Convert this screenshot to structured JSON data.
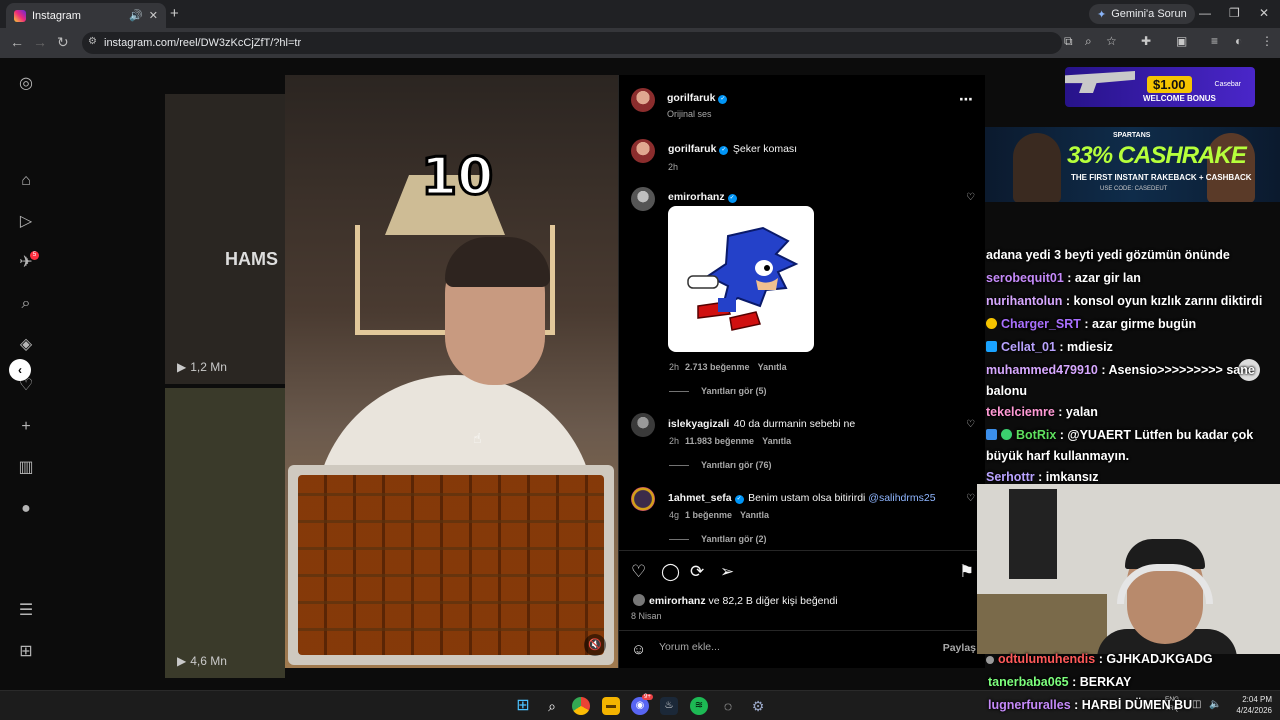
{
  "browser": {
    "tab_title": "Instagram",
    "gemini_label": "Gemini'a Sorun",
    "url": "instagram.com/reel/DW3zKcCjZfT/?hl=tr"
  },
  "left_nav": {
    "notification_count": "5"
  },
  "background_tiles": {
    "hams_text": "HAMS",
    "views_top": "1,2 Mn",
    "views_bottom": "4,6 Mn"
  },
  "video": {
    "countdown": "10"
  },
  "post": {
    "author": "gorilfaruk",
    "audio": "Orijinal ses",
    "caption_author": "gorilfaruk",
    "caption": "Şeker koması",
    "caption_time": "2h",
    "likes_text": "emirorhanz ve 82,2 B diğer kişi beğendi",
    "likes_user": "emirorhanz",
    "likes_rest": " ve 82,2 B diğer kişi beğendi",
    "date": "8 Nisan",
    "comment_placeholder": "Yorum ekle...",
    "share_label": "Paylaş"
  },
  "comments": [
    {
      "user": "emirorhanz",
      "text": "",
      "time": "2h",
      "likes": "2.713 beğenme",
      "reply": "Yanıtla",
      "view_replies": "Yanıtları gör (5)"
    },
    {
      "user": "islekyagizali",
      "text": "40 da durmanin sebebi ne",
      "time": "2h",
      "likes": "11.983 beğenme",
      "reply": "Yanıtla",
      "view_replies": "Yanıtları gör (76)"
    },
    {
      "user": "1ahmet_sefa",
      "text": "Benim ustam olsa bitirirdi ",
      "mention": "@salihdrms25",
      "time": "4g",
      "likes": "1 beğenme",
      "reply": "Yanıtla",
      "view_replies": "Yanıtları gör (2)"
    }
  ],
  "ads": {
    "ad1_amount": "$1.00",
    "ad1_text": "WELCOME BONUS",
    "ad1_brand": "Casebar",
    "ad2_brand": "SPARTANS",
    "ad2_big": "33% CASHRAKE",
    "ad2_line": "THE FIRST INSTANT RAKEBACK + CASHBACK",
    "ad2_code": "USE CODE: CASEDEUT"
  },
  "chat": [
    {
      "name": "",
      "name_color": "#ffffff",
      "text": "adana yedi 3 beyti yedi gözümün önünde"
    },
    {
      "name": "serobequit01",
      "name_color": "#c58af9",
      "text": " : azar gir lan"
    },
    {
      "name": "nurihantolun",
      "name_color": "#d7a8ff",
      "text": " : konsol oyun kızlık zarını diktirdi"
    },
    {
      "name": "Charger_SRT",
      "name_color": "#a970ff",
      "text": " : azar girme bugün",
      "badge": "#f5c400"
    },
    {
      "name": "Cellat_01",
      "name_color": "#b9a3ff",
      "text": " : mdiesiz",
      "badge": "#1aa3ff"
    },
    {
      "name": "muhammed479910",
      "name_color": "#d7a8ff",
      "text": " : Asensio>>>>>>>>> sane balonu"
    },
    {
      "name": "tekelciemre",
      "name_color": "#ff9ad5",
      "text": " : yalan"
    },
    {
      "name": "BotRix",
      "name_color": "#5fe05f",
      "text": " : @YUAERT Lütfen bu kadar çok büyük harf kullanmayın.",
      "badge": "#3b8eea"
    },
    {
      "name": "Serhottr",
      "name_color": "#b9a3ff",
      "text": " : imkansız"
    },
    {
      "name": "odtulumuhendis",
      "name_color": "#ff5a5a",
      "text": " : GJHKADJKGADG"
    },
    {
      "name": "tanerbaba065",
      "name_color": "#7dff7d",
      "text": " : BERKAY"
    },
    {
      "name": "lugnerfuralles",
      "name_color": "#c58af9",
      "text": " : HARBİ DÜMEN BU"
    }
  ],
  "taskbar": {
    "time": "2:04 PM",
    "date": "4/24/2026",
    "lang": "ENG\nTRQ",
    "discord_badge": "9+"
  }
}
